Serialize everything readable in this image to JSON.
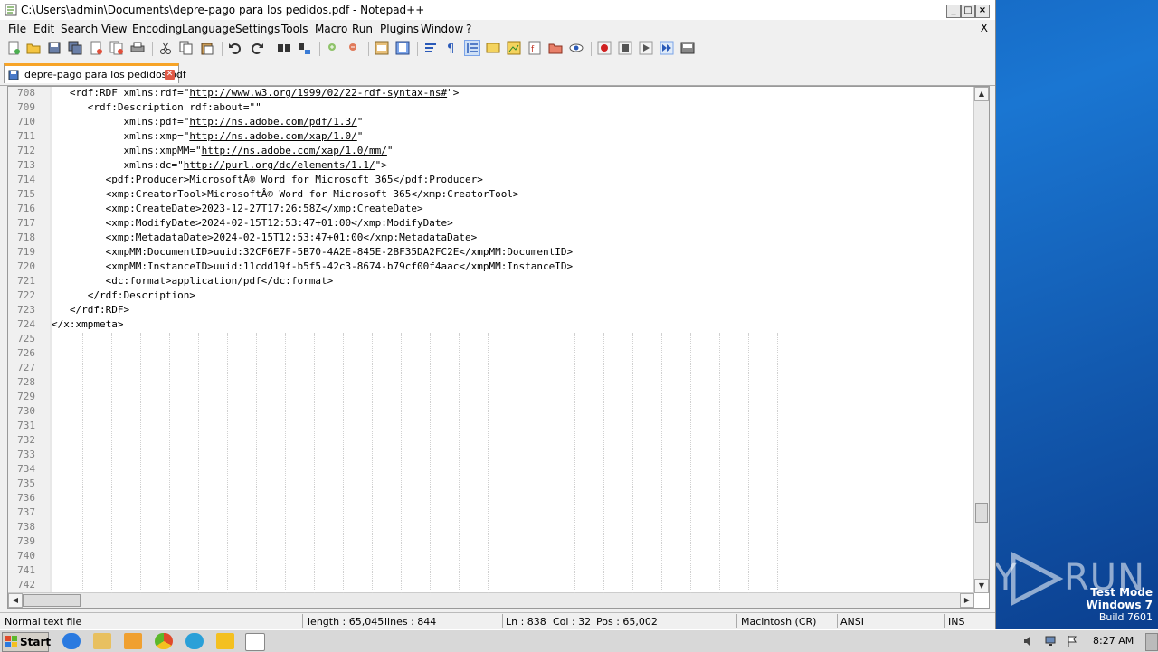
{
  "window": {
    "title": "C:\\Users\\admin\\Documents\\depre-pago para los pedidos.pdf - Notepad++"
  },
  "menu": {
    "items": [
      "File",
      "Edit",
      "Search",
      "View",
      "Encoding",
      "Language",
      "Settings",
      "Tools",
      "Macro",
      "Run",
      "Plugins",
      "Window",
      "?"
    ],
    "close": "X"
  },
  "tab": {
    "label": "depre-pago para los pedidos.pdf"
  },
  "editor": {
    "lines": [
      {
        "num": "708",
        "text": "   <rdf:RDF xmlns:rdf=\"",
        "url": "http://www.w3.org/1999/02/22-rdf-syntax-ns#",
        "tail": "\">"
      },
      {
        "num": "709",
        "text": "      <rdf:Description rdf:about=\"\"",
        "url": "",
        "tail": ""
      },
      {
        "num": "710",
        "text": "            xmlns:pdf=\"",
        "url": "http://ns.adobe.com/pdf/1.3/",
        "tail": "\""
      },
      {
        "num": "711",
        "text": "            xmlns:xmp=\"",
        "url": "http://ns.adobe.com/xap/1.0/",
        "tail": "\""
      },
      {
        "num": "712",
        "text": "            xmlns:xmpMM=\"",
        "url": "http://ns.adobe.com/xap/1.0/mm/",
        "tail": "\""
      },
      {
        "num": "713",
        "text": "            xmlns:dc=\"",
        "url": "http://purl.org/dc/elements/1.1/",
        "tail": "\">"
      },
      {
        "num": "714",
        "text": "         <pdf:Producer>MicrosoftÂ® Word for Microsoft 365</pdf:Producer>",
        "url": "",
        "tail": ""
      },
      {
        "num": "715",
        "text": "         <xmp:CreatorTool>MicrosoftÂ® Word for Microsoft 365</xmp:CreatorTool>",
        "url": "",
        "tail": ""
      },
      {
        "num": "716",
        "text": "         <xmp:CreateDate>2023-12-27T17:26:58Z</xmp:CreateDate>",
        "url": "",
        "tail": ""
      },
      {
        "num": "717",
        "text": "         <xmp:ModifyDate>2024-02-15T12:53:47+01:00</xmp:ModifyDate>",
        "url": "",
        "tail": ""
      },
      {
        "num": "718",
        "text": "         <xmp:MetadataDate>2024-02-15T12:53:47+01:00</xmp:MetadataDate>",
        "url": "",
        "tail": ""
      },
      {
        "num": "719",
        "text": "         <xmpMM:DocumentID>uuid:32CF6E7F-5B70-4A2E-845E-2BF35DA2FC2E</xmpMM:DocumentID>",
        "url": "",
        "tail": ""
      },
      {
        "num": "720",
        "text": "         <xmpMM:InstanceID>uuid:11cdd19f-b5f5-42c3-8674-b79cf00f4aac</xmpMM:InstanceID>",
        "url": "",
        "tail": ""
      },
      {
        "num": "721",
        "text": "         <dc:format>application/pdf</dc:format>",
        "url": "",
        "tail": ""
      },
      {
        "num": "722",
        "text": "      </rdf:Description>",
        "url": "",
        "tail": ""
      },
      {
        "num": "723",
        "text": "   </rdf:RDF>",
        "url": "",
        "tail": ""
      },
      {
        "num": "724",
        "text": "</x:xmpmeta>",
        "url": "",
        "tail": ""
      },
      {
        "num": "725",
        "text": "",
        "url": "",
        "tail": ""
      },
      {
        "num": "726",
        "text": "",
        "url": "",
        "tail": ""
      },
      {
        "num": "727",
        "text": "",
        "url": "",
        "tail": ""
      },
      {
        "num": "728",
        "text": "",
        "url": "",
        "tail": ""
      },
      {
        "num": "729",
        "text": "",
        "url": "",
        "tail": ""
      },
      {
        "num": "730",
        "text": "",
        "url": "",
        "tail": ""
      },
      {
        "num": "731",
        "text": "",
        "url": "",
        "tail": ""
      },
      {
        "num": "732",
        "text": "",
        "url": "",
        "tail": ""
      },
      {
        "num": "733",
        "text": "",
        "url": "",
        "tail": ""
      },
      {
        "num": "734",
        "text": "",
        "url": "",
        "tail": ""
      },
      {
        "num": "735",
        "text": "",
        "url": "",
        "tail": ""
      },
      {
        "num": "736",
        "text": "",
        "url": "",
        "tail": ""
      },
      {
        "num": "737",
        "text": "",
        "url": "",
        "tail": ""
      },
      {
        "num": "738",
        "text": "",
        "url": "",
        "tail": ""
      },
      {
        "num": "739",
        "text": "",
        "url": "",
        "tail": ""
      },
      {
        "num": "740",
        "text": "",
        "url": "",
        "tail": ""
      },
      {
        "num": "741",
        "text": "",
        "url": "",
        "tail": ""
      },
      {
        "num": "742",
        "text": "",
        "url": "",
        "tail": ""
      }
    ]
  },
  "status": {
    "type": "Normal text file",
    "length": "length : 65,045",
    "lines": "lines : 844",
    "ln": "Ln : 838",
    "col": "Col : 32",
    "pos": "Pos : 65,002",
    "eol": "Macintosh (CR)",
    "encoding": "ANSI",
    "mode": "INS"
  },
  "taskbar": {
    "start": "Start",
    "clock": "8:27 AM"
  },
  "desktop": {
    "watermark_left": "ANY",
    "watermark_right": "RUN",
    "testmode_line1": "Test Mode",
    "testmode_line2": "Windows 7",
    "testmode_line3": "Build 7601"
  },
  "icons": [
    "new-file-icon",
    "open-icon",
    "save-icon",
    "save-all-icon",
    "close-icon",
    "close-all-icon",
    "print-icon",
    "cut-icon",
    "copy-icon",
    "paste-icon",
    "undo-icon",
    "redo-icon",
    "find-icon",
    "replace-icon",
    "zoom-in-icon",
    "zoom-out-icon",
    "sync-v-icon",
    "sync-h-icon",
    "wrap-icon",
    "all-chars-icon",
    "indent-guide-icon",
    "udl-icon",
    "doc-map-icon",
    "function-list-icon",
    "folder-workspace-icon",
    "monitor-icon",
    "record-icon",
    "stop-icon",
    "play-icon",
    "play-multi-icon",
    "save-macro-icon"
  ]
}
